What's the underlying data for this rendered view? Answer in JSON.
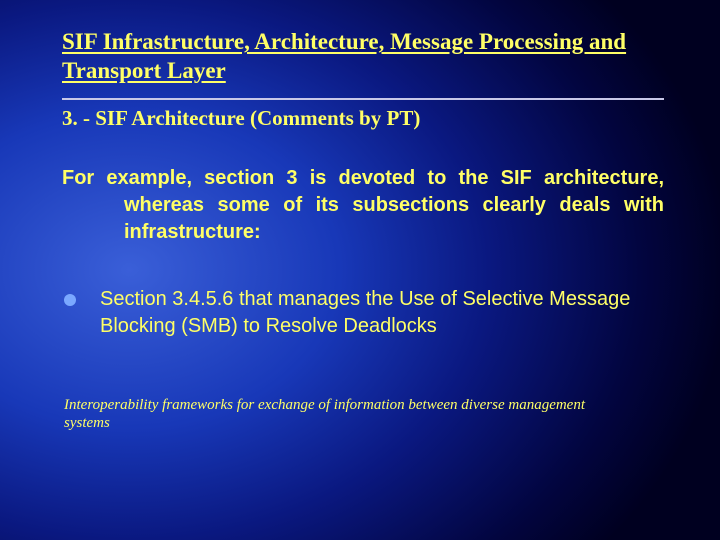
{
  "slide": {
    "title": "SIF Infrastructure, Architecture, Message Processing and Transport Layer",
    "subtitle": "3. - SIF Architecture (Comments by PT)",
    "body": "For example, section 3 is devoted to the SIF architecture, whereas some of its subsections clearly deals with infrastructure:",
    "bullet": "Section 3.4.5.6 that manages the Use of Selective Message Blocking (SMB) to Resolve Deadlocks",
    "footer": "Interoperability frameworks for exchange of information between diverse management systems"
  }
}
